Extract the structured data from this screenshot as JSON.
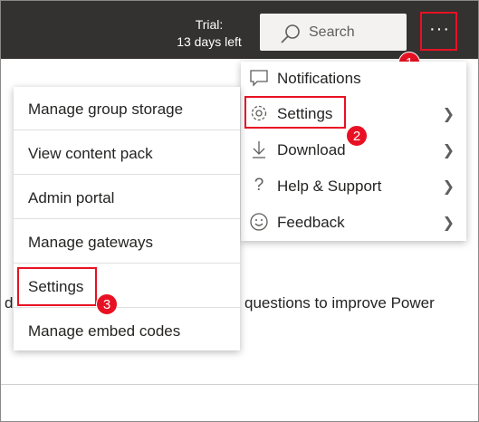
{
  "topbar": {
    "trial_line1": "Trial:",
    "trial_line2": "13 days left",
    "search_label": "Search",
    "more_label": "···"
  },
  "right_menu": [
    {
      "label": "Notifications",
      "icon": "chat-bubble-icon"
    },
    {
      "label": "Settings",
      "icon": "gear-icon"
    },
    {
      "label": "Download",
      "icon": "download-arrow-icon"
    },
    {
      "label": "Help & Support",
      "icon": "question-icon"
    },
    {
      "label": "Feedback",
      "icon": "smiley-icon"
    }
  ],
  "left_menu": [
    {
      "label": "Manage group storage"
    },
    {
      "label": "View content pack"
    },
    {
      "label": "Admin portal"
    },
    {
      "label": "Manage gateways"
    },
    {
      "label": "Settings"
    },
    {
      "label": "Manage embed codes"
    }
  ],
  "callouts": {
    "one": "1",
    "two": "2",
    "three": "3"
  },
  "background": {
    "left_fragment": "d",
    "right_fragment": "questions to improve Power"
  },
  "colors": {
    "topbar": "#333231",
    "highlight": "#e81123",
    "menu_bg": "#ffffff"
  }
}
